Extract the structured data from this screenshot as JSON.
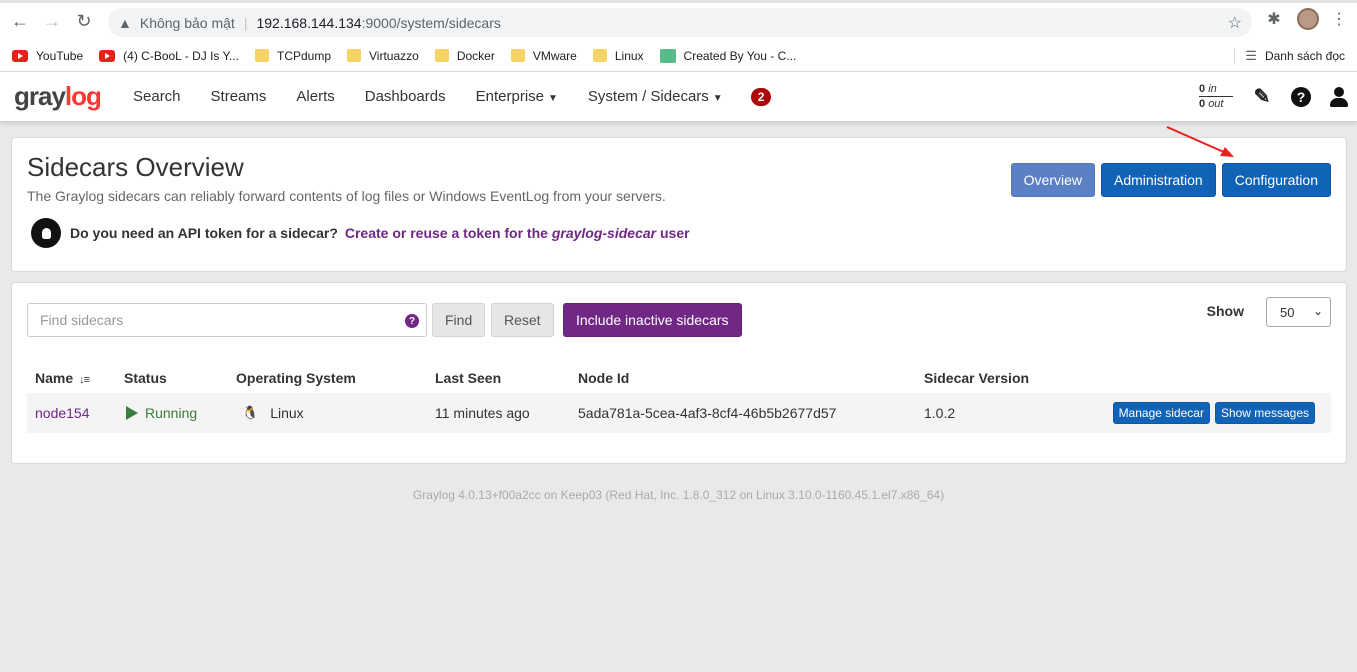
{
  "browser": {
    "back": "←",
    "forward": "→",
    "reload": "↻",
    "insecure_label": "Không bảo mật",
    "url_host": "192.168.144.134",
    "url_path": ":9000/system/sidecars",
    "bookmarks": [
      {
        "label": "YouTube",
        "icon": "youtube-icon"
      },
      {
        "label": "(4) C-BooL - DJ Is Y...",
        "icon": "youtube-icon"
      },
      {
        "label": "TCPdump",
        "icon": "folder-icon"
      },
      {
        "label": "Virtuazzo",
        "icon": "folder-icon"
      },
      {
        "label": "Docker",
        "icon": "folder-icon"
      },
      {
        "label": "VMware",
        "icon": "folder-icon"
      },
      {
        "label": "Linux",
        "icon": "folder-icon"
      },
      {
        "label": "Created By You - C...",
        "icon": "codebeautify-icon"
      }
    ],
    "reading_list": "Danh sách đọc"
  },
  "navbar": {
    "logo_part1": "gray",
    "logo_part2": "log",
    "items": [
      {
        "label": "Search"
      },
      {
        "label": "Streams"
      },
      {
        "label": "Alerts"
      },
      {
        "label": "Dashboards"
      },
      {
        "label": "Enterprise",
        "dropdown": true
      },
      {
        "label": "System / Sidecars",
        "dropdown": true
      }
    ],
    "notification_count": "2",
    "throughput_in_value": "0",
    "throughput_in_label": "in",
    "throughput_out_value": "0",
    "throughput_out_label": "out"
  },
  "header": {
    "title": "Sidecars Overview",
    "description": "The Graylog sidecars can reliably forward contents of log files or Windows EventLog from your servers.",
    "token_question": "Do you need an API token for a sidecar?",
    "token_link_prefix": "Create or reuse a token for the",
    "token_link_user": "graylog-sidecar",
    "token_link_suffix": "user",
    "buttons": {
      "overview": "Overview",
      "administration": "Administration",
      "configuration": "Configuration"
    }
  },
  "list": {
    "search_placeholder": "Find sidecars",
    "find_label": "Find",
    "reset_label": "Reset",
    "include_inactive_label": "Include inactive sidecars",
    "show_label": "Show",
    "show_value": "50",
    "columns": [
      "Name",
      "Status",
      "Operating System",
      "Last Seen",
      "Node Id",
      "Sidecar Version"
    ],
    "rows": [
      {
        "name": "node154",
        "status": "Running",
        "os": "Linux",
        "last_seen": "11 minutes ago",
        "node_id": "5ada781a-5cea-4af3-8cf4-46b5b2677d57",
        "version": "1.0.2",
        "manage_label": "Manage sidecar",
        "messages_label": "Show messages"
      }
    ]
  },
  "footer": {
    "text": "Graylog 4.0.13+f00a2cc on Keep03 (Red Hat, Inc. 1.8.0_312 on Linux 3.10.0-1160.45.1.el7.x86_64)"
  },
  "colors": {
    "brand_red": "#ff3633",
    "primary_blue": "#1163b8",
    "purple": "#702785",
    "running_green": "#3a7d3a",
    "badge_red": "#ad0707"
  }
}
